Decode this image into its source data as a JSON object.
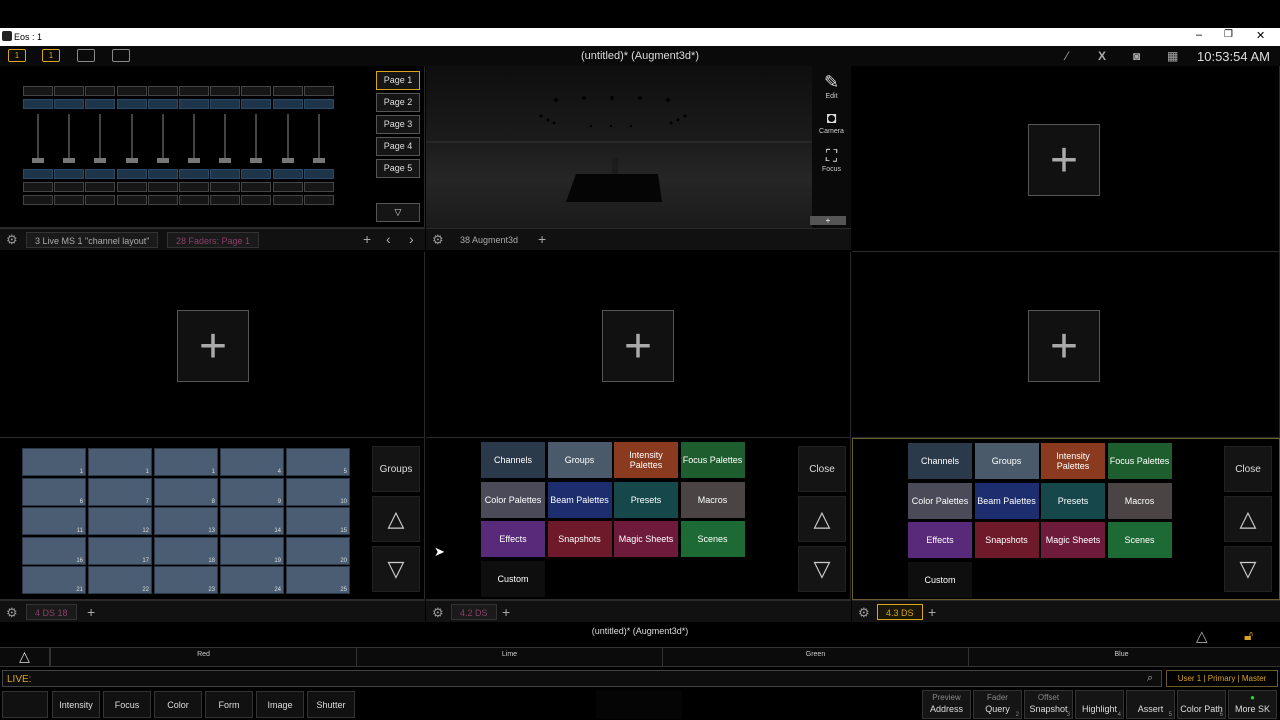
{
  "window": {
    "title": "Eos : 1"
  },
  "header": {
    "workspaces": [
      "1",
      "1",
      "",
      ""
    ],
    "show_title": "(untitled)* (Augment3d*)",
    "clock": "10:53:54 AM"
  },
  "top_left_frame": {
    "pages": [
      "Page 1",
      "Page 2",
      "Page 3",
      "Page 4",
      "Page 5"
    ],
    "tabs": [
      "3 Live MS 1 \"channel layout\"",
      "28 Faders: Page 1"
    ]
  },
  "augment3d": {
    "tools": [
      {
        "label": "Edit",
        "icon": "pencil-icon"
      },
      {
        "label": "Camera",
        "icon": "camera-icon"
      },
      {
        "label": "Focus",
        "icon": "focus-icon"
      }
    ],
    "tab": "38 Augment3d",
    "mini_button": "+"
  },
  "groups_frame": {
    "cells": [
      "1",
      "1",
      "1",
      "4",
      "5",
      "6",
      "7",
      "8",
      "9",
      "10",
      "11",
      "12",
      "13",
      "14",
      "15",
      "16",
      "17",
      "18",
      "19",
      "20",
      "21",
      "22",
      "23",
      "24",
      "25"
    ],
    "groups_label": "Groups",
    "tab": "4 DS 18"
  },
  "palette_frames": [
    {
      "tab": "4.2 DS",
      "close_label": "Close",
      "buttons": [
        {
          "label": "Channels",
          "color": "#2b3a4a"
        },
        {
          "label": "Groups",
          "color": "#4a5a6a"
        },
        {
          "label": "Intensity Palettes",
          "color": "#8a3a1e"
        },
        {
          "label": "Focus Palettes",
          "color": "#1e5e2e"
        },
        {
          "label": "Color Palettes",
          "color": "#4a4a58"
        },
        {
          "label": "Beam Palettes",
          "color": "#1c2e6e"
        },
        {
          "label": "Presets",
          "color": "#16474a"
        },
        {
          "label": "Macros",
          "color": "#4a4444"
        },
        {
          "label": "Effects",
          "color": "#5a2a7a"
        },
        {
          "label": "Snapshots",
          "color": "#6e1a2a"
        },
        {
          "label": "Magic Sheets",
          "color": "#6e1a3a"
        },
        {
          "label": "Scenes",
          "color": "#1e6a34"
        },
        {
          "label": "Custom",
          "color": "#0e0e0e"
        }
      ]
    },
    {
      "tab": "4.3 DS",
      "close_label": "Close",
      "buttons": [
        {
          "label": "Channels",
          "color": "#2b3a4a"
        },
        {
          "label": "Groups",
          "color": "#4a5a6a"
        },
        {
          "label": "Intensity Palettes",
          "color": "#8a3a1e"
        },
        {
          "label": "Focus Palettes",
          "color": "#1e5e2e"
        },
        {
          "label": "Color Palettes",
          "color": "#4a4a58"
        },
        {
          "label": "Beam Palettes",
          "color": "#1c2e6e"
        },
        {
          "label": "Presets",
          "color": "#16474a"
        },
        {
          "label": "Macros",
          "color": "#4a4444"
        },
        {
          "label": "Effects",
          "color": "#5a2a7a"
        },
        {
          "label": "Snapshots",
          "color": "#6e1a2a"
        },
        {
          "label": "Magic Sheets",
          "color": "#6e1a3a"
        },
        {
          "label": "Scenes",
          "color": "#1e6a34"
        },
        {
          "label": "Custom",
          "color": "#0e0e0e"
        }
      ]
    }
  ],
  "status": {
    "show_title": "(untitled)* (Augment3d*)",
    "mixer": [
      "Red",
      "Lime",
      "Green",
      "Blue"
    ],
    "command_line": "LIVE:",
    "user_info": "User 1 | Primary | Master"
  },
  "softkeys": [
    "Intensity",
    "Focus",
    "Color",
    "Form",
    "Image",
    "Shutter"
  ],
  "right_keys": [
    {
      "top": "Preview",
      "bottom": "Address",
      "num": ""
    },
    {
      "top": "Fader",
      "bottom": "Query",
      "num": "2"
    },
    {
      "top": "Offset",
      "bottom": "Snapshot",
      "num": "3"
    },
    {
      "top": "",
      "bottom": "Highlight",
      "num": "4"
    },
    {
      "top": "",
      "bottom": "Assert",
      "num": "5"
    },
    {
      "top": "",
      "bottom": "Color Path",
      "num": "6"
    },
    {
      "top": "",
      "bottom": "More SK",
      "num": ""
    }
  ],
  "colors": {
    "accent": "#d9a520",
    "magenta_tab": "#8a3f6a"
  }
}
